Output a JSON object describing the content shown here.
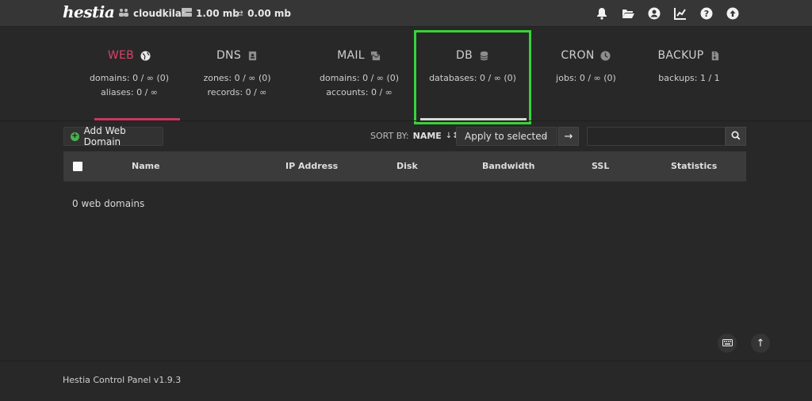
{
  "topbar": {
    "logo": "hestia",
    "user": "cloudkilat",
    "disk": "1.00 mb",
    "bandwidth": "0.00 mb"
  },
  "tabs": {
    "web": {
      "title": "WEB",
      "line1": "domains: 0 / ∞ (0)",
      "line2": "aliases: 0 / ∞"
    },
    "dns": {
      "title": "DNS",
      "line1": "zones: 0 / ∞ (0)",
      "line2": "records: 0 / ∞"
    },
    "mail": {
      "title": "MAIL",
      "line1": "domains: 0 / ∞ (0)",
      "line2": "accounts: 0 / ∞"
    },
    "db": {
      "title": "DB",
      "line1": "databases: 0 / ∞ (0)"
    },
    "cron": {
      "title": "CRON",
      "line1": "jobs: 0 / ∞ (0)"
    },
    "backup": {
      "title": "BACKUP",
      "line1": "backups: 1 / 1"
    }
  },
  "toolbar": {
    "add_label": "Add Web Domain",
    "sort_label": "SORT BY:",
    "sort_value": "NAME",
    "apply_label": "Apply to selected",
    "search_value": ""
  },
  "table": {
    "columns": [
      "Name",
      "IP Address",
      "Disk",
      "Bandwidth",
      "SSL",
      "Statistics"
    ],
    "count_text": "0 web domains"
  },
  "footer": {
    "text": "Hestia Control Panel v1.9.3"
  },
  "colors": {
    "accent": "#c8385f",
    "highlight": "#37d33a"
  }
}
